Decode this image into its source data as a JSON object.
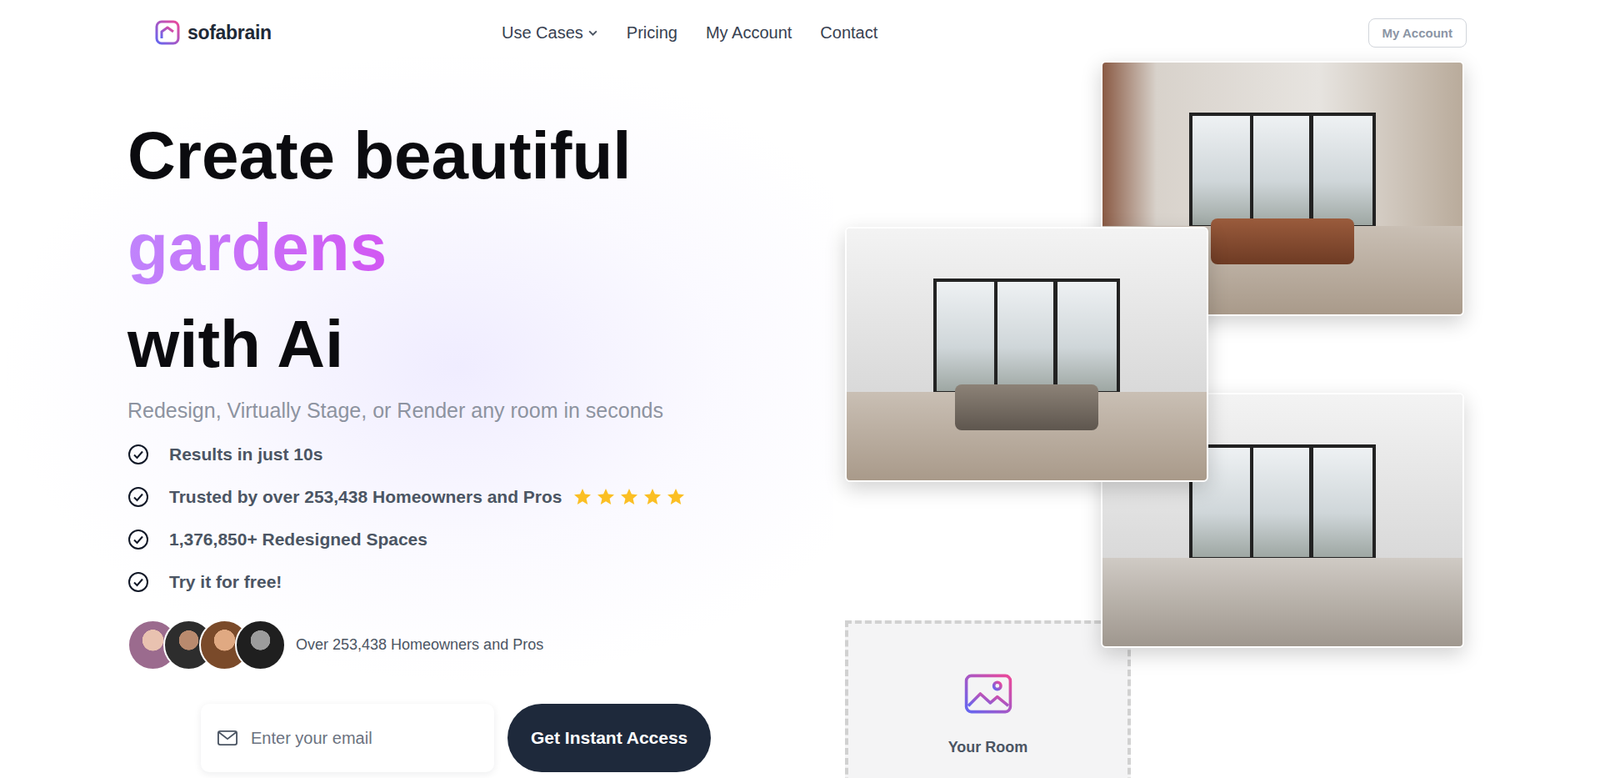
{
  "logo": {
    "text": "sofabrain"
  },
  "nav": {
    "items": [
      {
        "label": "Use Cases",
        "dropdown": true
      },
      {
        "label": "Pricing",
        "dropdown": false
      },
      {
        "label": "My Account",
        "dropdown": false
      },
      {
        "label": "Contact",
        "dropdown": false
      }
    ],
    "account_button": "My Account"
  },
  "hero": {
    "title_lines": [
      {
        "text": "Create beautiful",
        "highlight": false
      },
      {
        "text": "gardens",
        "highlight": true
      },
      {
        "text": "with Ai",
        "highlight": false
      }
    ],
    "subtitle": "Redesign, Virtually Stage, or Render any room in seconds",
    "features": [
      {
        "text": "Results in just 10s",
        "stars": 0
      },
      {
        "text": "Trusted by over 253,438 Homeowners and Pros",
        "stars": 5
      },
      {
        "text": "1,376,850+ Redesigned Spaces",
        "stars": 0
      },
      {
        "text": "Try it for free!",
        "stars": 0
      }
    ]
  },
  "social_proof": {
    "avatar_count": 4,
    "text": "Over 253,438 Homeowners and Pros"
  },
  "signup": {
    "placeholder": "Enter your email",
    "button": "Get Instant Access"
  },
  "upload": {
    "label": "Your Room"
  }
}
